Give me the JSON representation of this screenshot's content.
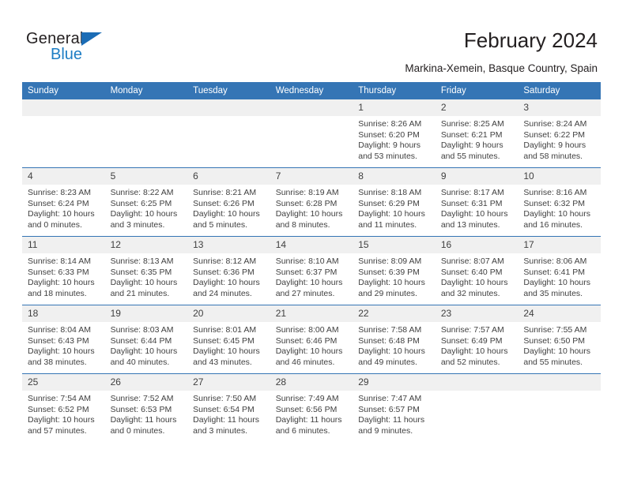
{
  "brand": {
    "name_top": "General",
    "name_bottom": "Blue",
    "triangle_color": "#1b6cb5",
    "blue_color": "#1d7dc4"
  },
  "header": {
    "title": "February 2024",
    "subtitle": "Markina-Xemein, Basque Country, Spain",
    "accent_color": "#3575b5",
    "band_color": "#f0f0f0"
  },
  "weekdays": [
    "Sunday",
    "Monday",
    "Tuesday",
    "Wednesday",
    "Thursday",
    "Friday",
    "Saturday"
  ],
  "weeks": [
    [
      {
        "day": "",
        "sunrise": "",
        "sunset": "",
        "daylight1": "",
        "daylight2": ""
      },
      {
        "day": "",
        "sunrise": "",
        "sunset": "",
        "daylight1": "",
        "daylight2": ""
      },
      {
        "day": "",
        "sunrise": "",
        "sunset": "",
        "daylight1": "",
        "daylight2": ""
      },
      {
        "day": "",
        "sunrise": "",
        "sunset": "",
        "daylight1": "",
        "daylight2": ""
      },
      {
        "day": "1",
        "sunrise": "Sunrise: 8:26 AM",
        "sunset": "Sunset: 6:20 PM",
        "daylight1": "Daylight: 9 hours",
        "daylight2": "and 53 minutes."
      },
      {
        "day": "2",
        "sunrise": "Sunrise: 8:25 AM",
        "sunset": "Sunset: 6:21 PM",
        "daylight1": "Daylight: 9 hours",
        "daylight2": "and 55 minutes."
      },
      {
        "day": "3",
        "sunrise": "Sunrise: 8:24 AM",
        "sunset": "Sunset: 6:22 PM",
        "daylight1": "Daylight: 9 hours",
        "daylight2": "and 58 minutes."
      }
    ],
    [
      {
        "day": "4",
        "sunrise": "Sunrise: 8:23 AM",
        "sunset": "Sunset: 6:24 PM",
        "daylight1": "Daylight: 10 hours",
        "daylight2": "and 0 minutes."
      },
      {
        "day": "5",
        "sunrise": "Sunrise: 8:22 AM",
        "sunset": "Sunset: 6:25 PM",
        "daylight1": "Daylight: 10 hours",
        "daylight2": "and 3 minutes."
      },
      {
        "day": "6",
        "sunrise": "Sunrise: 8:21 AM",
        "sunset": "Sunset: 6:26 PM",
        "daylight1": "Daylight: 10 hours",
        "daylight2": "and 5 minutes."
      },
      {
        "day": "7",
        "sunrise": "Sunrise: 8:19 AM",
        "sunset": "Sunset: 6:28 PM",
        "daylight1": "Daylight: 10 hours",
        "daylight2": "and 8 minutes."
      },
      {
        "day": "8",
        "sunrise": "Sunrise: 8:18 AM",
        "sunset": "Sunset: 6:29 PM",
        "daylight1": "Daylight: 10 hours",
        "daylight2": "and 11 minutes."
      },
      {
        "day": "9",
        "sunrise": "Sunrise: 8:17 AM",
        "sunset": "Sunset: 6:31 PM",
        "daylight1": "Daylight: 10 hours",
        "daylight2": "and 13 minutes."
      },
      {
        "day": "10",
        "sunrise": "Sunrise: 8:16 AM",
        "sunset": "Sunset: 6:32 PM",
        "daylight1": "Daylight: 10 hours",
        "daylight2": "and 16 minutes."
      }
    ],
    [
      {
        "day": "11",
        "sunrise": "Sunrise: 8:14 AM",
        "sunset": "Sunset: 6:33 PM",
        "daylight1": "Daylight: 10 hours",
        "daylight2": "and 18 minutes."
      },
      {
        "day": "12",
        "sunrise": "Sunrise: 8:13 AM",
        "sunset": "Sunset: 6:35 PM",
        "daylight1": "Daylight: 10 hours",
        "daylight2": "and 21 minutes."
      },
      {
        "day": "13",
        "sunrise": "Sunrise: 8:12 AM",
        "sunset": "Sunset: 6:36 PM",
        "daylight1": "Daylight: 10 hours",
        "daylight2": "and 24 minutes."
      },
      {
        "day": "14",
        "sunrise": "Sunrise: 8:10 AM",
        "sunset": "Sunset: 6:37 PM",
        "daylight1": "Daylight: 10 hours",
        "daylight2": "and 27 minutes."
      },
      {
        "day": "15",
        "sunrise": "Sunrise: 8:09 AM",
        "sunset": "Sunset: 6:39 PM",
        "daylight1": "Daylight: 10 hours",
        "daylight2": "and 29 minutes."
      },
      {
        "day": "16",
        "sunrise": "Sunrise: 8:07 AM",
        "sunset": "Sunset: 6:40 PM",
        "daylight1": "Daylight: 10 hours",
        "daylight2": "and 32 minutes."
      },
      {
        "day": "17",
        "sunrise": "Sunrise: 8:06 AM",
        "sunset": "Sunset: 6:41 PM",
        "daylight1": "Daylight: 10 hours",
        "daylight2": "and 35 minutes."
      }
    ],
    [
      {
        "day": "18",
        "sunrise": "Sunrise: 8:04 AM",
        "sunset": "Sunset: 6:43 PM",
        "daylight1": "Daylight: 10 hours",
        "daylight2": "and 38 minutes."
      },
      {
        "day": "19",
        "sunrise": "Sunrise: 8:03 AM",
        "sunset": "Sunset: 6:44 PM",
        "daylight1": "Daylight: 10 hours",
        "daylight2": "and 40 minutes."
      },
      {
        "day": "20",
        "sunrise": "Sunrise: 8:01 AM",
        "sunset": "Sunset: 6:45 PM",
        "daylight1": "Daylight: 10 hours",
        "daylight2": "and 43 minutes."
      },
      {
        "day": "21",
        "sunrise": "Sunrise: 8:00 AM",
        "sunset": "Sunset: 6:46 PM",
        "daylight1": "Daylight: 10 hours",
        "daylight2": "and 46 minutes."
      },
      {
        "day": "22",
        "sunrise": "Sunrise: 7:58 AM",
        "sunset": "Sunset: 6:48 PM",
        "daylight1": "Daylight: 10 hours",
        "daylight2": "and 49 minutes."
      },
      {
        "day": "23",
        "sunrise": "Sunrise: 7:57 AM",
        "sunset": "Sunset: 6:49 PM",
        "daylight1": "Daylight: 10 hours",
        "daylight2": "and 52 minutes."
      },
      {
        "day": "24",
        "sunrise": "Sunrise: 7:55 AM",
        "sunset": "Sunset: 6:50 PM",
        "daylight1": "Daylight: 10 hours",
        "daylight2": "and 55 minutes."
      }
    ],
    [
      {
        "day": "25",
        "sunrise": "Sunrise: 7:54 AM",
        "sunset": "Sunset: 6:52 PM",
        "daylight1": "Daylight: 10 hours",
        "daylight2": "and 57 minutes."
      },
      {
        "day": "26",
        "sunrise": "Sunrise: 7:52 AM",
        "sunset": "Sunset: 6:53 PM",
        "daylight1": "Daylight: 11 hours",
        "daylight2": "and 0 minutes."
      },
      {
        "day": "27",
        "sunrise": "Sunrise: 7:50 AM",
        "sunset": "Sunset: 6:54 PM",
        "daylight1": "Daylight: 11 hours",
        "daylight2": "and 3 minutes."
      },
      {
        "day": "28",
        "sunrise": "Sunrise: 7:49 AM",
        "sunset": "Sunset: 6:56 PM",
        "daylight1": "Daylight: 11 hours",
        "daylight2": "and 6 minutes."
      },
      {
        "day": "29",
        "sunrise": "Sunrise: 7:47 AM",
        "sunset": "Sunset: 6:57 PM",
        "daylight1": "Daylight: 11 hours",
        "daylight2": "and 9 minutes."
      },
      {
        "day": "",
        "sunrise": "",
        "sunset": "",
        "daylight1": "",
        "daylight2": ""
      },
      {
        "day": "",
        "sunrise": "",
        "sunset": "",
        "daylight1": "",
        "daylight2": ""
      }
    ]
  ]
}
